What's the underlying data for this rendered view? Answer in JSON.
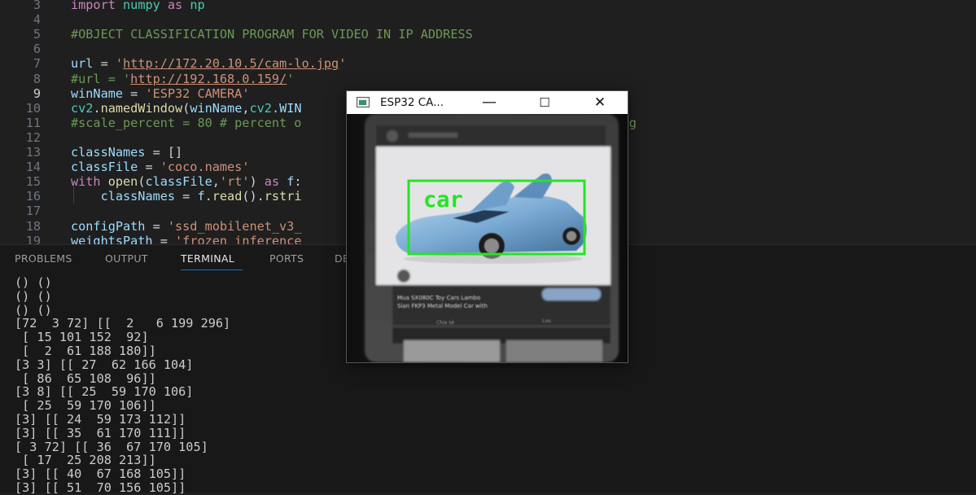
{
  "editor": {
    "lines": [
      {
        "num": "3",
        "tokens": [
          {
            "t": "import",
            "c": "kw"
          },
          {
            "t": " ",
            "c": "pl"
          },
          {
            "t": "numpy",
            "c": "mod"
          },
          {
            "t": " ",
            "c": "pl"
          },
          {
            "t": "as",
            "c": "kw"
          },
          {
            "t": " ",
            "c": "pl"
          },
          {
            "t": "np",
            "c": "mod"
          }
        ]
      },
      {
        "num": "4",
        "tokens": []
      },
      {
        "num": "5",
        "tokens": [
          {
            "t": "#OBJECT CLASSIFICATION PROGRAM FOR VIDEO IN IP ADDRESS",
            "c": "com"
          }
        ]
      },
      {
        "num": "6",
        "tokens": []
      },
      {
        "num": "7",
        "tokens": [
          {
            "t": "url",
            "c": "var"
          },
          {
            "t": " = ",
            "c": "pl"
          },
          {
            "t": "'",
            "c": "str"
          },
          {
            "t": "http://172.20.10.5/cam-lo.jpg",
            "c": "str-u"
          },
          {
            "t": "'",
            "c": "str"
          }
        ]
      },
      {
        "num": "8",
        "tokens": [
          {
            "t": "#url = '",
            "c": "com"
          },
          {
            "t": "http://192.168.0.159/",
            "c": "str-u"
          },
          {
            "t": "'",
            "c": "com"
          }
        ]
      },
      {
        "num": "9",
        "active": true,
        "tokens": [
          {
            "t": "winName",
            "c": "var"
          },
          {
            "t": " = ",
            "c": "pl"
          },
          {
            "t": "'ESP32 CAMERA'",
            "c": "str"
          }
        ]
      },
      {
        "num": "10",
        "tokens": [
          {
            "t": "cv2",
            "c": "mod"
          },
          {
            "t": ".",
            "c": "pl"
          },
          {
            "t": "namedWindow",
            "c": "fn"
          },
          {
            "t": "(",
            "c": "pl"
          },
          {
            "t": "winName",
            "c": "var"
          },
          {
            "t": ",",
            "c": "pl"
          },
          {
            "t": "cv2",
            "c": "mod"
          },
          {
            "t": ".WIN",
            "c": "var"
          }
        ]
      },
      {
        "num": "11",
        "tokens": [
          {
            "t": "#scale_percent = 80 # percent o",
            "c": "com"
          },
          {
            "t": "                                    ",
            "c": "pl"
          },
          {
            "t": "rocessing",
            "c": "com"
          }
        ]
      },
      {
        "num": "12",
        "tokens": []
      },
      {
        "num": "13",
        "tokens": [
          {
            "t": "classNames",
            "c": "var"
          },
          {
            "t": " = []",
            "c": "pl"
          }
        ]
      },
      {
        "num": "14",
        "tokens": [
          {
            "t": "classFile",
            "c": "var"
          },
          {
            "t": " = ",
            "c": "pl"
          },
          {
            "t": "'coco.names'",
            "c": "str"
          }
        ]
      },
      {
        "num": "15",
        "tokens": [
          {
            "t": "with",
            "c": "kw"
          },
          {
            "t": " ",
            "c": "pl"
          },
          {
            "t": "open",
            "c": "fn"
          },
          {
            "t": "(",
            "c": "pl"
          },
          {
            "t": "classFile",
            "c": "var"
          },
          {
            "t": ",",
            "c": "pl"
          },
          {
            "t": "'rt'",
            "c": "str"
          },
          {
            "t": ") ",
            "c": "pl"
          },
          {
            "t": "as",
            "c": "kw"
          },
          {
            "t": " ",
            "c": "pl"
          },
          {
            "t": "f",
            "c": "var"
          },
          {
            "t": ":",
            "c": "pl"
          }
        ]
      },
      {
        "num": "16",
        "tokens": [
          {
            "t": "    ",
            "c": "pl"
          },
          {
            "t": "classNames",
            "c": "var"
          },
          {
            "t": " = ",
            "c": "pl"
          },
          {
            "t": "f",
            "c": "var"
          },
          {
            "t": ".",
            "c": "pl"
          },
          {
            "t": "read",
            "c": "fn"
          },
          {
            "t": "().",
            "c": "pl"
          },
          {
            "t": "rstri",
            "c": "fn"
          }
        ]
      },
      {
        "num": "17",
        "tokens": []
      },
      {
        "num": "18",
        "tokens": [
          {
            "t": "configPath",
            "c": "var"
          },
          {
            "t": " = ",
            "c": "pl"
          },
          {
            "t": "'ssd_mobilenet_v3_",
            "c": "str"
          }
        ]
      },
      {
        "num": "19",
        "tokens": [
          {
            "t": "weightsPath",
            "c": "var"
          },
          {
            "t": " = ",
            "c": "pl"
          },
          {
            "t": "'frozen_inference",
            "c": "str"
          }
        ]
      }
    ]
  },
  "panel": {
    "tabs": [
      {
        "label": "PROBLEMS",
        "name": "tab-problems"
      },
      {
        "label": "OUTPUT",
        "name": "tab-output"
      },
      {
        "label": "TERMINAL",
        "name": "tab-terminal",
        "active": true
      },
      {
        "label": "PORTS",
        "name": "tab-ports"
      },
      {
        "label": "DE",
        "name": "tab-debug-console"
      }
    ],
    "terminal_lines": [
      "() ()",
      "() ()",
      "() ()",
      "[72  3 72] [[  2   6 199 296]",
      " [ 15 101 152  92]",
      " [  2  61 188 180]]",
      "[3 3] [[ 27  62 166 104]",
      " [ 86  65 108  96]]",
      "[3 8] [[ 25  59 170 106]",
      " [ 25  59 170 106]]",
      "[3] [[ 24  59 173 112]]",
      "[3] [[ 35  61 170 111]]",
      "[ 3 72] [[ 36  67 170 105]",
      " [ 17  25 208 213]]",
      "[3] [[ 40  67 168 105]]",
      "[3] [[ 51  70 156 105]]"
    ]
  },
  "camera_window": {
    "title": "ESP32 CA...",
    "minimize_glyph": "—",
    "maximize_glyph": "☐",
    "close_glyph": "✕",
    "icon": "app-window-icon",
    "detection_label": "car",
    "detection_color": "#22e622",
    "blurred_text_1": "Mua SX080C Toy Cars Lambo",
    "blurred_text_2": "Sian FKP3 Metal Model Car with"
  }
}
